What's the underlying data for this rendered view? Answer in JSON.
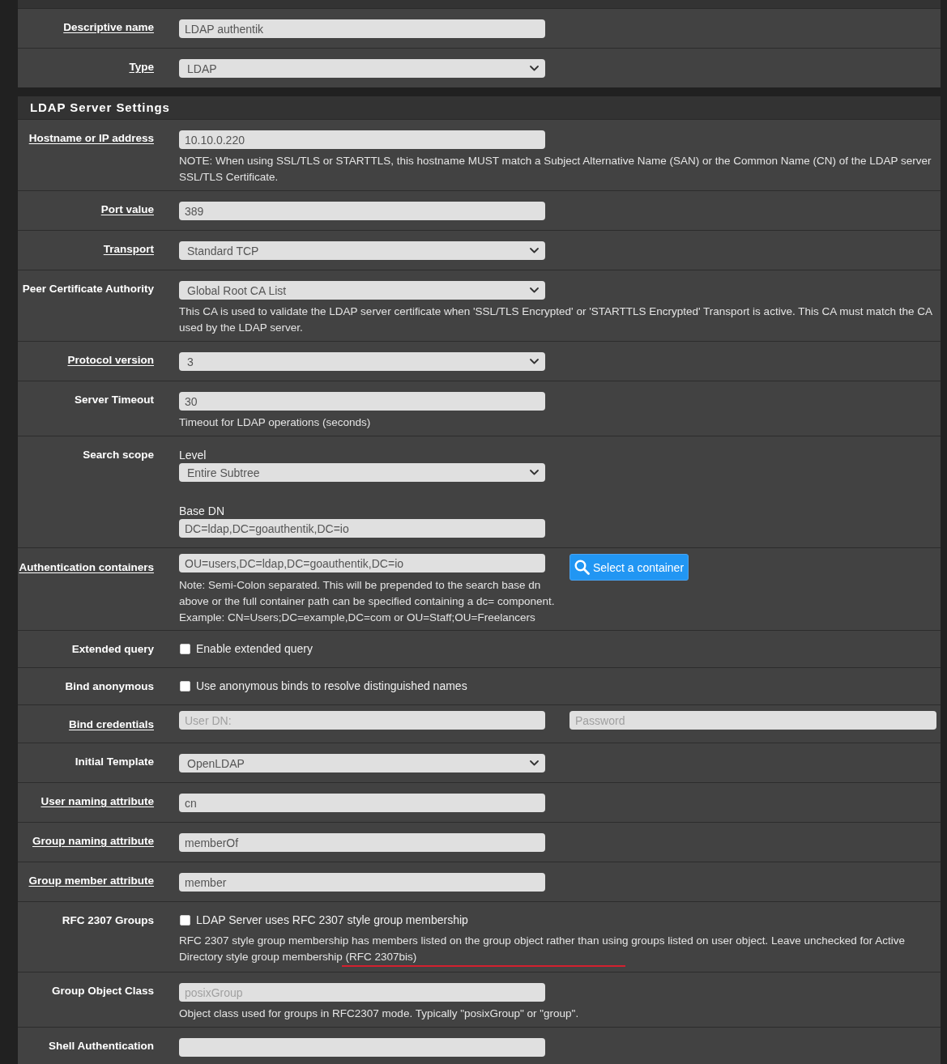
{
  "top_panel": {
    "rows": [
      {
        "kind": "input",
        "label": "Descriptive name",
        "help": true,
        "value": "LDAP authentik"
      },
      {
        "kind": "select",
        "label": "Type",
        "help": true,
        "value": "LDAP"
      }
    ]
  },
  "ldap_panel": {
    "title": "LDAP Server Settings",
    "rows": [
      {
        "kind": "input",
        "label": "Hostname or IP address",
        "help": true,
        "value": "10.10.0.220",
        "note": "NOTE: When using SSL/TLS or STARTTLS, this hostname MUST match a Subject Alternative Name (SAN) or the Common Name (CN) of the LDAP server SSL/TLS Certificate."
      },
      {
        "kind": "input",
        "label": "Port value",
        "help": true,
        "value": "389"
      },
      {
        "kind": "select",
        "label": "Transport",
        "help": true,
        "value": "Standard TCP"
      },
      {
        "kind": "select",
        "label": "Peer Certificate Authority",
        "help": false,
        "value": "Global Root CA List",
        "note": "This CA is used to validate the LDAP server certificate when 'SSL/TLS Encrypted' or 'STARTTLS Encrypted' Transport is active. This CA must match the CA used by the LDAP server."
      },
      {
        "kind": "select",
        "label": "Protocol version",
        "help": true,
        "value": "3"
      },
      {
        "kind": "input",
        "label": "Server Timeout",
        "help": false,
        "value": "30",
        "note": "Timeout for LDAP operations (seconds)"
      },
      {
        "kind": "group",
        "label": "Search scope",
        "help": false,
        "fields": [
          {
            "kind": "select",
            "caption": "Level",
            "value": "Entire Subtree"
          },
          {
            "kind": "input",
            "caption": "Base DN",
            "value": "DC=ldap,DC=goauthentik,DC=io"
          }
        ]
      },
      {
        "kind": "container",
        "label": "Authentication containers",
        "help": true,
        "value": "OU=users,DC=ldap,DC=goauthentik,DC=io",
        "button": "Select a container",
        "notes": [
          "Note: Semi-Colon separated. This will be prepended to the search base dn above or the full container path can be specified containing a dc= component.",
          "Example: CN=Users;DC=example,DC=com or OU=Staff;OU=Freelancers"
        ]
      },
      {
        "kind": "checkbox",
        "label": "Extended query",
        "help": false,
        "checked": false,
        "text": "Enable extended query"
      },
      {
        "kind": "checkbox",
        "label": "Bind anonymous",
        "help": false,
        "checked": false,
        "text": "Use anonymous binds to resolve distinguished names"
      },
      {
        "kind": "pair",
        "label": "Bind credentials",
        "help": true,
        "fields": [
          {
            "placeholder": "User DN:"
          },
          {
            "placeholder": "Password"
          }
        ]
      },
      {
        "kind": "select",
        "label": "Initial Template",
        "help": false,
        "value": "OpenLDAP"
      },
      {
        "kind": "input",
        "label": "User naming attribute",
        "help": true,
        "value": "cn"
      },
      {
        "kind": "input",
        "label": "Group naming attribute",
        "help": true,
        "value": "memberOf"
      },
      {
        "kind": "input",
        "label": "Group member attribute",
        "help": true,
        "value": "member"
      },
      {
        "kind": "checkbox",
        "label": "RFC 2307 Groups",
        "help": false,
        "checked": false,
        "text": "LDAP Server uses RFC 2307 style group membership",
        "note": "RFC 2307 style group membership has members listed on the group object rather than using groups listed on user object. Leave unchecked for Active Directory style group membership (RFC 2307bis)",
        "annotation_line": true
      },
      {
        "kind": "input",
        "label": "Group Object Class",
        "help": false,
        "placeholder": "posixGroup",
        "note": "Object class used for groups in RFC2307 mode. Typically \"posixGroup\" or \"group\"."
      },
      {
        "kind": "input",
        "label": "Shell Authentication",
        "help": false
      }
    ]
  }
}
